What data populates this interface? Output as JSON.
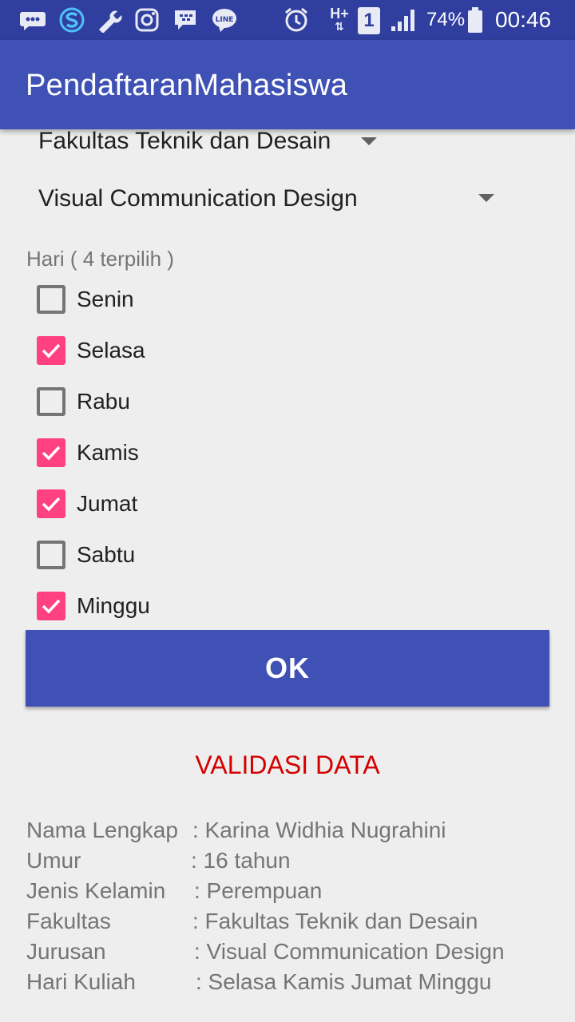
{
  "status_bar": {
    "battery": "74%",
    "time": "00:46",
    "network": "H+",
    "sim": "1",
    "icons": [
      "bbm-icon",
      "s-icon",
      "wrench-icon",
      "instagram-icon",
      "blackberry-messenger-icon",
      "line-icon",
      "alarm-icon",
      "signal-icon",
      "battery-icon"
    ]
  },
  "app_bar": {
    "title": "PendaftaranMahasiswa"
  },
  "form": {
    "fakultas": "Fakultas Teknik dan Desain",
    "jurusan": "Visual Communication Design",
    "hari_label": "Hari ( 4 terpilih )",
    "days": [
      {
        "label": "Senin",
        "checked": false
      },
      {
        "label": "Selasa",
        "checked": true
      },
      {
        "label": "Rabu",
        "checked": false
      },
      {
        "label": "Kamis",
        "checked": true
      },
      {
        "label": "Jumat",
        "checked": true
      },
      {
        "label": "Sabtu",
        "checked": false
      },
      {
        "label": "Minggu",
        "checked": true
      }
    ],
    "ok_label": "OK"
  },
  "validation": {
    "title": "VALIDASI DATA",
    "rows": [
      {
        "key": "Nama Lengkap",
        "value": ": Karina Widhia Nugrahini"
      },
      {
        "key": "Umur",
        "value": ": 16 tahun"
      },
      {
        "key": "Jenis Kelamin",
        "value": ": Perempuan"
      },
      {
        "key": "Fakultas",
        "value": ": Fakultas Teknik dan Desain"
      },
      {
        "key": "Jurusan",
        "value": ": Visual Communication Design"
      },
      {
        "key": "Hari Kuliah",
        "value": ": Selasa Kamis Jumat Minggu"
      }
    ]
  },
  "colors": {
    "primary": "#3f51b5",
    "primary_dark": "#303f9f",
    "accent": "#ff4081",
    "validation_title": "#d50000"
  }
}
